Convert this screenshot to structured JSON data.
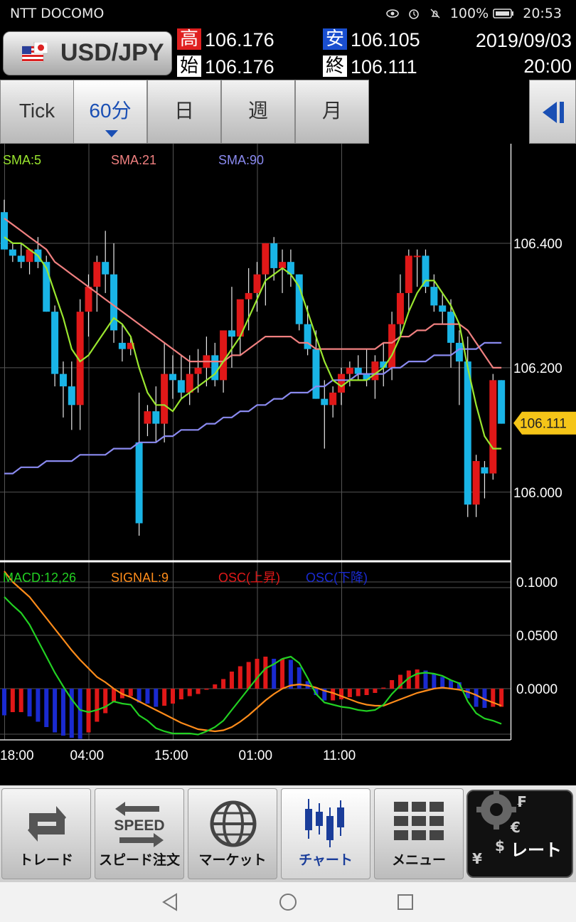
{
  "status_bar": {
    "carrier": "NTT DOCOMO",
    "battery": "100%",
    "time": "20:53"
  },
  "header": {
    "symbol": "USD/JPY",
    "high_label": "高",
    "high_value": "106.176",
    "low_label": "安",
    "low_value": "106.105",
    "open_label": "始",
    "open_value": "106.176",
    "close_label": "終",
    "close_value": "106.111",
    "date": "2019/09/03",
    "time": "20:00",
    "colors": {
      "high_bg": "#e02020",
      "low_bg": "#1a4fd0"
    }
  },
  "tabs": [
    {
      "label": "Tick"
    },
    {
      "label": "60分",
      "active": true
    },
    {
      "label": "日"
    },
    {
      "label": "週"
    },
    {
      "label": "月"
    }
  ],
  "chart_data": [
    {
      "type": "candlestick",
      "title": "",
      "legend": [
        {
          "name": "SMA:5",
          "color": "#9ae62f"
        },
        {
          "name": "SMA:21",
          "color": "#f08080"
        },
        {
          "name": "SMA:90",
          "color": "#8a8af0"
        }
      ],
      "y_ticks": [
        "106.400",
        "106.200",
        "106.000"
      ],
      "ylim": [
        105.89,
        106.56
      ],
      "current_price": "106.111",
      "up_color": "#e01818",
      "down_color": "#19b4e6",
      "candles": [
        [
          106.45,
          106.47,
          106.42,
          106.39
        ],
        [
          106.39,
          106.4,
          106.37,
          106.38
        ],
        [
          106.38,
          106.4,
          106.36,
          106.37
        ],
        [
          106.37,
          106.39,
          106.35,
          106.39
        ],
        [
          106.39,
          106.41,
          106.36,
          106.37
        ],
        [
          106.37,
          106.38,
          106.29,
          106.29
        ],
        [
          106.29,
          106.3,
          106.17,
          106.19
        ],
        [
          106.19,
          106.21,
          106.12,
          106.17
        ],
        [
          106.17,
          106.21,
          106.1,
          106.14
        ],
        [
          106.14,
          106.31,
          106.1,
          106.29
        ],
        [
          106.29,
          106.35,
          106.25,
          106.33
        ],
        [
          106.33,
          106.38,
          106.29,
          106.37
        ],
        [
          106.37,
          106.42,
          106.32,
          106.35
        ],
        [
          106.35,
          106.4,
          106.24,
          106.26
        ],
        [
          106.24,
          106.27,
          106.21,
          106.23
        ],
        [
          106.23,
          106.25,
          106.22,
          106.24
        ],
        [
          106.08,
          106.16,
          105.93,
          105.95
        ],
        [
          106.11,
          106.14,
          106.09,
          106.13
        ],
        [
          106.13,
          106.17,
          106.08,
          106.11
        ],
        [
          106.11,
          106.24,
          106.08,
          106.19
        ],
        [
          106.19,
          106.22,
          106.15,
          106.18
        ],
        [
          106.18,
          106.22,
          106.15,
          106.16
        ],
        [
          106.16,
          106.22,
          106.14,
          106.19
        ],
        [
          106.19,
          106.23,
          106.16,
          106.2
        ],
        [
          106.2,
          106.25,
          106.17,
          106.22
        ],
        [
          106.22,
          106.24,
          106.17,
          106.18
        ],
        [
          106.18,
          106.24,
          106.16,
          106.26
        ],
        [
          106.26,
          106.33,
          106.2,
          106.25
        ],
        [
          106.25,
          106.3,
          106.22,
          106.31
        ],
        [
          106.31,
          106.36,
          106.26,
          106.32
        ],
        [
          106.32,
          106.37,
          106.29,
          106.35
        ],
        [
          106.35,
          106.4,
          106.3,
          106.4
        ],
        [
          106.4,
          106.41,
          106.34,
          106.36
        ],
        [
          106.36,
          106.39,
          106.32,
          106.37
        ],
        [
          106.37,
          106.39,
          106.33,
          106.35
        ],
        [
          106.35,
          106.35,
          106.26,
          106.27
        ],
        [
          106.27,
          106.3,
          106.22,
          106.23
        ],
        [
          106.23,
          106.26,
          106.15,
          106.15
        ],
        [
          106.15,
          106.18,
          106.07,
          106.14
        ],
        [
          106.14,
          106.17,
          106.12,
          106.16
        ],
        [
          106.16,
          106.2,
          106.14,
          106.19
        ],
        [
          106.19,
          106.21,
          106.17,
          106.2
        ],
        [
          106.2,
          106.22,
          106.18,
          106.19
        ],
        [
          106.19,
          106.23,
          106.17,
          106.18
        ],
        [
          106.18,
          106.22,
          106.15,
          106.21
        ],
        [
          106.21,
          106.24,
          106.17,
          106.2
        ],
        [
          106.2,
          106.29,
          106.18,
          106.27
        ],
        [
          106.27,
          106.35,
          106.25,
          106.32
        ],
        [
          106.32,
          106.39,
          106.29,
          106.38
        ],
        [
          106.38,
          106.39,
          106.33,
          106.38
        ],
        [
          106.38,
          106.39,
          106.32,
          106.33
        ],
        [
          106.33,
          106.35,
          106.29,
          106.3
        ],
        [
          106.3,
          106.32,
          106.27,
          106.29
        ],
        [
          106.29,
          106.31,
          106.2,
          106.24
        ],
        [
          106.24,
          106.26,
          106.14,
          106.21
        ],
        [
          106.21,
          106.25,
          105.96,
          105.98
        ],
        [
          105.98,
          106.06,
          105.96,
          106.05
        ],
        [
          106.04,
          106.05,
          105.99,
          106.03
        ],
        [
          106.03,
          106.19,
          106.02,
          106.18
        ],
        [
          106.18,
          106.18,
          106.11,
          106.11
        ]
      ],
      "sma5": [
        106.41,
        106.4,
        106.4,
        106.39,
        106.38,
        106.36,
        106.32,
        106.28,
        106.23,
        106.21,
        106.22,
        106.24,
        106.26,
        106.28,
        106.27,
        106.25,
        106.2,
        106.16,
        106.14,
        106.14,
        106.13,
        106.15,
        106.16,
        106.17,
        106.18,
        106.19,
        106.21,
        106.23,
        106.25,
        106.28,
        106.31,
        106.34,
        106.35,
        106.36,
        106.35,
        106.33,
        106.29,
        106.25,
        106.21,
        106.18,
        106.17,
        106.18,
        106.18,
        106.18,
        106.19,
        106.2,
        106.22,
        106.25,
        106.29,
        106.32,
        106.34,
        106.34,
        106.32,
        106.3,
        106.27,
        106.2,
        106.14,
        106.09,
        106.07,
        106.07
      ],
      "sma21": [
        106.44,
        106.43,
        106.42,
        106.41,
        106.4,
        106.39,
        106.37,
        106.36,
        106.35,
        106.34,
        106.33,
        106.32,
        106.31,
        106.3,
        106.29,
        106.28,
        106.27,
        106.26,
        106.25,
        106.24,
        106.23,
        106.22,
        106.21,
        106.21,
        106.21,
        106.21,
        106.21,
        106.22,
        106.22,
        106.23,
        106.24,
        106.25,
        106.25,
        106.25,
        106.25,
        106.24,
        106.24,
        106.23,
        106.23,
        106.23,
        106.23,
        106.23,
        106.23,
        106.23,
        106.23,
        106.24,
        106.24,
        106.25,
        106.25,
        106.26,
        106.26,
        106.27,
        106.27,
        106.27,
        106.27,
        106.26,
        106.24,
        106.22,
        106.2,
        106.2
      ],
      "sma90": [
        106.03,
        106.03,
        106.04,
        106.04,
        106.04,
        106.05,
        106.05,
        106.05,
        106.05,
        106.06,
        106.06,
        106.06,
        106.06,
        106.07,
        106.07,
        106.07,
        106.08,
        106.08,
        106.08,
        106.09,
        106.09,
        106.1,
        106.1,
        106.1,
        106.11,
        106.11,
        106.12,
        106.12,
        106.13,
        106.13,
        106.14,
        106.14,
        106.15,
        106.15,
        106.16,
        106.16,
        106.16,
        106.17,
        106.17,
        106.18,
        106.18,
        106.18,
        106.19,
        106.19,
        106.19,
        106.19,
        106.2,
        106.2,
        106.21,
        106.21,
        106.21,
        106.22,
        106.22,
        106.22,
        106.23,
        106.23,
        106.23,
        106.24,
        106.24,
        106.24
      ]
    },
    {
      "type": "bar",
      "title": "",
      "legend": [
        {
          "name": "MACD:12,26",
          "color": "#22d022"
        },
        {
          "name": "SIGNAL:9",
          "color": "#ff8c1a"
        },
        {
          "name": "OSC(上昇)",
          "color": "#e01818"
        },
        {
          "name": "OSC(下降)",
          "color": "#1a2ad0"
        }
      ],
      "y_ticks": [
        "0.1000",
        "0.0500",
        "0.0000"
      ],
      "ylim": [
        -0.048,
        0.118
      ],
      "macd": [
        0.086,
        0.078,
        0.071,
        0.06,
        0.045,
        0.03,
        0.015,
        0.002,
        -0.01,
        -0.02,
        -0.022,
        -0.02,
        -0.017,
        -0.012,
        -0.014,
        -0.015,
        -0.025,
        -0.03,
        -0.037,
        -0.04,
        -0.042,
        -0.042,
        -0.042,
        -0.043,
        -0.04,
        -0.036,
        -0.03,
        -0.02,
        -0.01,
        0.0,
        0.01,
        0.019,
        0.023,
        0.028,
        0.03,
        0.024,
        0.01,
        -0.005,
        -0.013,
        -0.015,
        -0.017,
        -0.018,
        -0.02,
        -0.021,
        -0.02,
        -0.015,
        -0.005,
        0.003,
        0.01,
        0.014,
        0.015,
        0.014,
        0.012,
        0.008,
        0.005,
        -0.012,
        -0.023,
        -0.028,
        -0.03,
        -0.033
      ],
      "signal": [
        0.11,
        0.1,
        0.093,
        0.086,
        0.076,
        0.066,
        0.056,
        0.046,
        0.036,
        0.027,
        0.019,
        0.011,
        0.006,
        0.0,
        -0.005,
        -0.008,
        -0.012,
        -0.016,
        -0.02,
        -0.024,
        -0.028,
        -0.032,
        -0.035,
        -0.038,
        -0.039,
        -0.04,
        -0.039,
        -0.036,
        -0.031,
        -0.025,
        -0.018,
        -0.011,
        -0.005,
        0.0,
        0.003,
        0.004,
        0.003,
        0.001,
        -0.002,
        -0.004,
        -0.007,
        -0.01,
        -0.013,
        -0.015,
        -0.016,
        -0.016,
        -0.013,
        -0.01,
        -0.007,
        -0.004,
        -0.002,
        0.0,
        0.001,
        0.0,
        -0.001,
        -0.003,
        -0.006,
        -0.01,
        -0.013,
        -0.016
      ],
      "osc": [
        -0.025,
        -0.022,
        -0.022,
        -0.026,
        -0.031,
        -0.036,
        -0.041,
        -0.044,
        -0.046,
        -0.047,
        -0.041,
        -0.031,
        -0.023,
        -0.012,
        -0.009,
        -0.007,
        -0.013,
        -0.014,
        -0.017,
        -0.016,
        -0.014,
        -0.01,
        -0.007,
        -0.005,
        -0.001,
        0.004,
        0.009,
        0.016,
        0.021,
        0.025,
        0.028,
        0.03,
        0.028,
        0.028,
        0.027,
        0.02,
        0.007,
        -0.006,
        -0.011,
        -0.011,
        -0.01,
        -0.008,
        -0.007,
        -0.006,
        -0.004,
        0.001,
        0.008,
        0.013,
        0.017,
        0.018,
        0.017,
        0.014,
        0.011,
        0.008,
        0.006,
        -0.009,
        -0.017,
        -0.018,
        -0.017,
        -0.017
      ]
    }
  ],
  "x_axis": {
    "labels": [
      "18:00",
      "04:00",
      "15:00",
      "01:00",
      "11:00"
    ],
    "label_index": [
      0,
      10,
      20,
      30,
      40
    ]
  },
  "bottom_nav": [
    {
      "label": "トレード",
      "icon": "trade-icon"
    },
    {
      "label": "スピード注文",
      "icon": "speed-icon",
      "icon_text": "SPEED"
    },
    {
      "label": "マーケット",
      "icon": "globe-icon"
    },
    {
      "label": "チャート",
      "icon": "chart-icon",
      "active": true
    },
    {
      "label": "メニュー",
      "icon": "grid-icon"
    },
    {
      "label": "レート",
      "icon": "gear-currency-icon"
    }
  ]
}
